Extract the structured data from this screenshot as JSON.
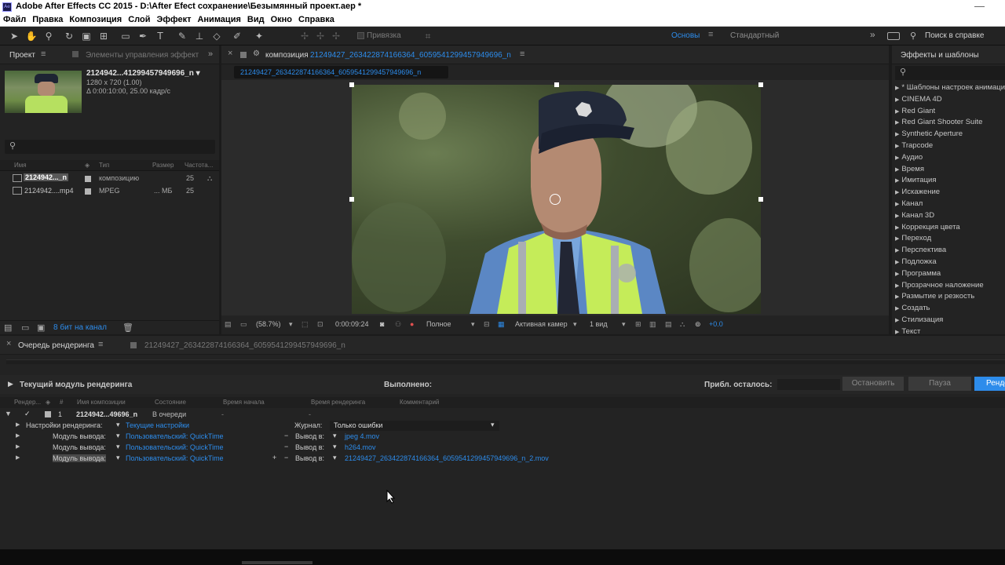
{
  "window": {
    "title": "Adobe After Effects CC 2015 - D:\\After Efect сохранение\\Безымянный проект.aep *",
    "app_icon_text": "Ae"
  },
  "menu": [
    "Файл",
    "Правка",
    "Композиция",
    "Слой",
    "Эффект",
    "Анимация",
    "Вид",
    "Окно",
    "Справка"
  ],
  "toolbar": {
    "snap_label": "Привязка",
    "workspace_basic": "Основы",
    "workspace_standard": "Стандартный",
    "search_help": "Поиск в справке"
  },
  "project": {
    "tab_label": "Проект",
    "effects_controls_tab": "Элементы управления эффект",
    "selected_name": "2124942...41299457949696_n ▾",
    "selected_dims": "1280 x 720 (1.00)",
    "selected_duration": "Δ 0:00:10:00, 25.00 кадр/с",
    "columns": [
      "Имя",
      "Тип",
      "Размер",
      "Частота..."
    ],
    "items": [
      {
        "name": "2124942..._n",
        "type": "композицию",
        "size": "",
        "fps": "25",
        "color": "#b5b5b5"
      },
      {
        "name": "2124942....mp4",
        "type": "MPEG",
        "size": "... МБ",
        "fps": "25",
        "color": "#b5b5b5"
      }
    ],
    "bit_depth": "8 бит на канал"
  },
  "composition": {
    "panel_label": "композиция",
    "panel_name": "21249427_263422874166364_6059541299457949696_n",
    "tab_name": "21249427_263422874166364_6059541299457949696_n",
    "zoom": "(58.7%)",
    "timecode": "0:00:09:24",
    "resolution": "Полное",
    "camera": "Активная камер",
    "views": "1 вид",
    "exposure": "+0.0"
  },
  "effects": {
    "panel_label": "Эффекты и шаблоны",
    "search_placeholder": "",
    "categories": [
      "* Шаблоны настроек анимации",
      "CINEMA 4D",
      "Red Giant",
      "Red Giant Shooter Suite",
      "Synthetic Aperture",
      "Trapcode",
      "Аудио",
      "Время",
      "Имитация",
      "Искажение",
      "Канал",
      "Канал 3D",
      "Коррекция цвета",
      "Переход",
      "Перспектива",
      "Подложка",
      "Программа",
      "Прозрачное наложение",
      "Размытие и резкость",
      "Создать",
      "Стилизация",
      "Текст"
    ]
  },
  "render_queue": {
    "tab_label": "Очередь рендеринга",
    "comp_tab": "21249427_263422874166364_6059541299457949696_n",
    "current_module": "Текущий модуль рендеринга",
    "done_label": "Выполнено:",
    "remaining_label": "Прибл. осталось:",
    "stop_button": "Остановить",
    "pause_button": "Пауза",
    "render_button": "Рендеринг",
    "columns": [
      "Рендер...",
      "#",
      "Имя композиции",
      "Состояние",
      "Время начала",
      "Время рендеринга",
      "Комментарий"
    ],
    "item": {
      "index": "1",
      "name": "2124942...49696_n",
      "status": "В очереди",
      "start": "-",
      "render_time": "-"
    },
    "render_settings_label": "Настройки рендеринга:",
    "render_settings_value": "Текущие настройки",
    "log_label": "Журнал:",
    "log_value": "Только ошибки",
    "output_module_label": "Модуль вывода:",
    "output_to_label": "Вывод в:",
    "modules": [
      {
        "module": "Пользовательский: QuickTime",
        "output": "jpeg 4.mov"
      },
      {
        "module": "Пользовательский: QuickTime",
        "output": "h264.mov"
      },
      {
        "module": "Пользовательский: QuickTime",
        "output": "21249427_263422874166364_6059541299457949696_n_2.mov"
      }
    ]
  },
  "colors": {
    "accent": "#2d8ceb",
    "panel_bg": "#232323",
    "render_button_bg": "#2d8ceb"
  }
}
